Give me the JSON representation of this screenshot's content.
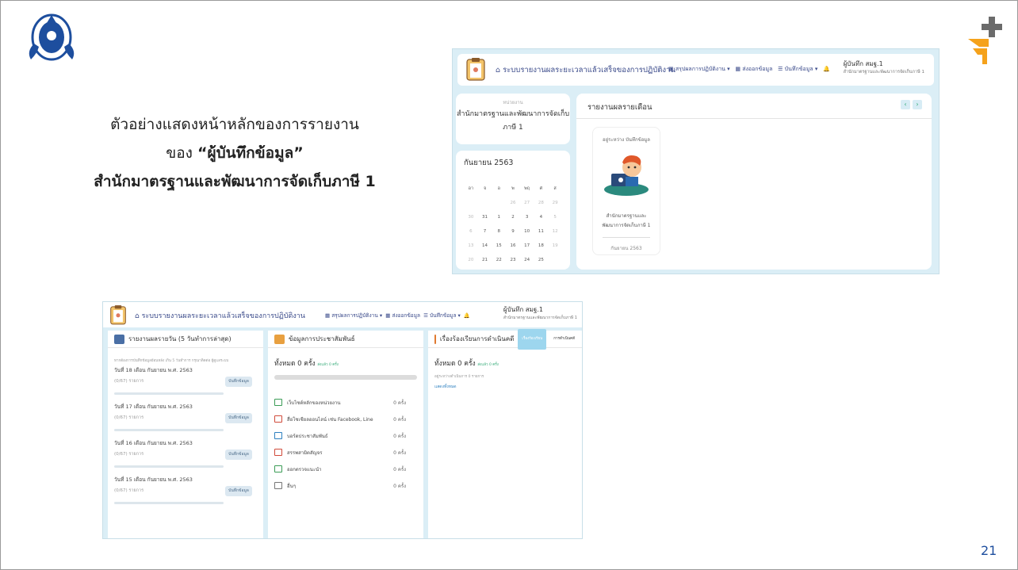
{
  "slide": {
    "caption_line1": "ตัวอย่างแสดงหน้าหลักของการรายงาน",
    "caption_line2_prefix": "ของ ",
    "caption_line2_bold": "“ผู้บันทึกข้อมูล”",
    "caption_line3": "สำนักมาตรฐานและพัฒนาการจัดเก็บภาษี 1",
    "logo_text": "กรมสรรพสามิต",
    "page_number": "21"
  },
  "colors": {
    "accent": "#1d4e9e",
    "brand_orange": "#f5a21b",
    "brand_gray": "#6b6b6b",
    "panel_bg": "#dbeef6"
  },
  "main_screen": {
    "app_title": "ระบบรายงานผลระยะเวลาแล้วเสร็จของการปฏิบัติงาน",
    "menu": {
      "summary": "สรุปผลการปฏิบัติงาน",
      "report": "ส่งออกข้อมูล",
      "record": "บันทึกข้อมูล"
    },
    "user_name": "ผู้บันทึก สมฐ.1",
    "user_unit": "สำนักมาตรฐานและพัฒนาการจัดเก็บภาษี 1",
    "unit_label": "หน่วยงาน",
    "unit_name_1": "สำนักมาตรฐานและพัฒนาการจัดเก็บ",
    "unit_name_2": "ภาษี 1",
    "calendar": {
      "month": "กันยายน 2563",
      "weekdays": [
        "อา",
        "จ",
        "อ",
        "พ",
        "พฤ",
        "ศ",
        "ส"
      ],
      "rows": [
        [
          "",
          "",
          "",
          "26",
          "27",
          "28",
          "29"
        ],
        [
          "30",
          "31",
          "1",
          "2",
          "3",
          "4",
          "5"
        ],
        [
          "6",
          "7",
          "8",
          "9",
          "10",
          "11",
          "12"
        ],
        [
          "13",
          "14",
          "15",
          "16",
          "17",
          "18",
          "19"
        ],
        [
          "20",
          "21",
          "22",
          "23",
          "24",
          "25",
          ""
        ]
      ]
    },
    "monthly": {
      "title": "รายงานผลรายเดือน",
      "prev": "‹",
      "next": "›",
      "status": "อยู่ระหว่าง บันทึกข้อมูล",
      "unit_1": "สำนักมาตรฐานและ",
      "unit_2": "พัฒนาการจัดเก็บภาษี 1",
      "date": "กันยายน 2563"
    }
  },
  "daily_screen": {
    "app_title": "ระบบรายงานผลระยะเวลาแล้วเสร็จของการปฏิบัติงาน",
    "menu": {
      "summary": "สรุปผลการปฏิบัติงาน",
      "report": "ส่งออกข้อมูล",
      "record": "บันทึกข้อมูล"
    },
    "user_name": "ผู้บันทึก สมฐ.1",
    "user_unit": "สำนักมาตรฐานและพัฒนาการจัดเก็บภาษี 1",
    "daily": {
      "title": "รายงานผลรายวัน (5 วันทำการล่าสุด)",
      "note": "หากต้องการบันทึกข้อมูลย้อนหลัง เกิน 5 วันทำการ กรุณาติดต่อ ผู้ดูแลระบบ",
      "button": "บันทึกข้อมูล",
      "days": [
        {
          "date": "วันที่ 18 เดือน กันยายน พ.ศ. 2563",
          "count": "(0/67) รายการ"
        },
        {
          "date": "วันที่ 17 เดือน กันยายน พ.ศ. 2563",
          "count": "(0/67) รายการ"
        },
        {
          "date": "วันที่ 16 เดือน กันยายน พ.ศ. 2563",
          "count": "(0/67) รายการ"
        },
        {
          "date": "วันที่ 15 เดือน กันยายน พ.ศ. 2563",
          "count": "(0/67) รายการ"
        }
      ]
    },
    "pr": {
      "title": "ข้อมูลการประชาสัมพันธ์",
      "total": "ทั้งหมด 0 ครั้ง",
      "sub": "ส่งแล้ว 0 ครั้ง",
      "items": [
        {
          "label": "เว็บไซต์หลักของหน่วยงาน",
          "value": "0 ครั้ง"
        },
        {
          "label": "สื่อโซเชียลออนไลน์ เช่น Facebook, Line",
          "value": "0 ครั้ง"
        },
        {
          "label": "บอร์ดประชาสัมพันธ์",
          "value": "0 ครั้ง"
        },
        {
          "label": "สรรพสามิตสัญจร",
          "value": "0 ครั้ง"
        },
        {
          "label": "ออกตรวจแนะนำ",
          "value": "0 ครั้ง"
        },
        {
          "label": "อื่นๆ",
          "value": "0 ครั้ง"
        }
      ]
    },
    "complaint": {
      "title": "เรื่องร้องเรียนการดำเนินคดี",
      "tab_active": "เรื่องร้องเรียน",
      "tab_other": "การดำเนินคดี",
      "total": "ทั้งหมด 0 ครั้ง",
      "sub": "ส่งแล้ว 0 ครั้ง",
      "pending": "อยู่ระหว่างดำเนินการ 0 รายการ",
      "link": "แสดงทั้งหมด"
    }
  }
}
